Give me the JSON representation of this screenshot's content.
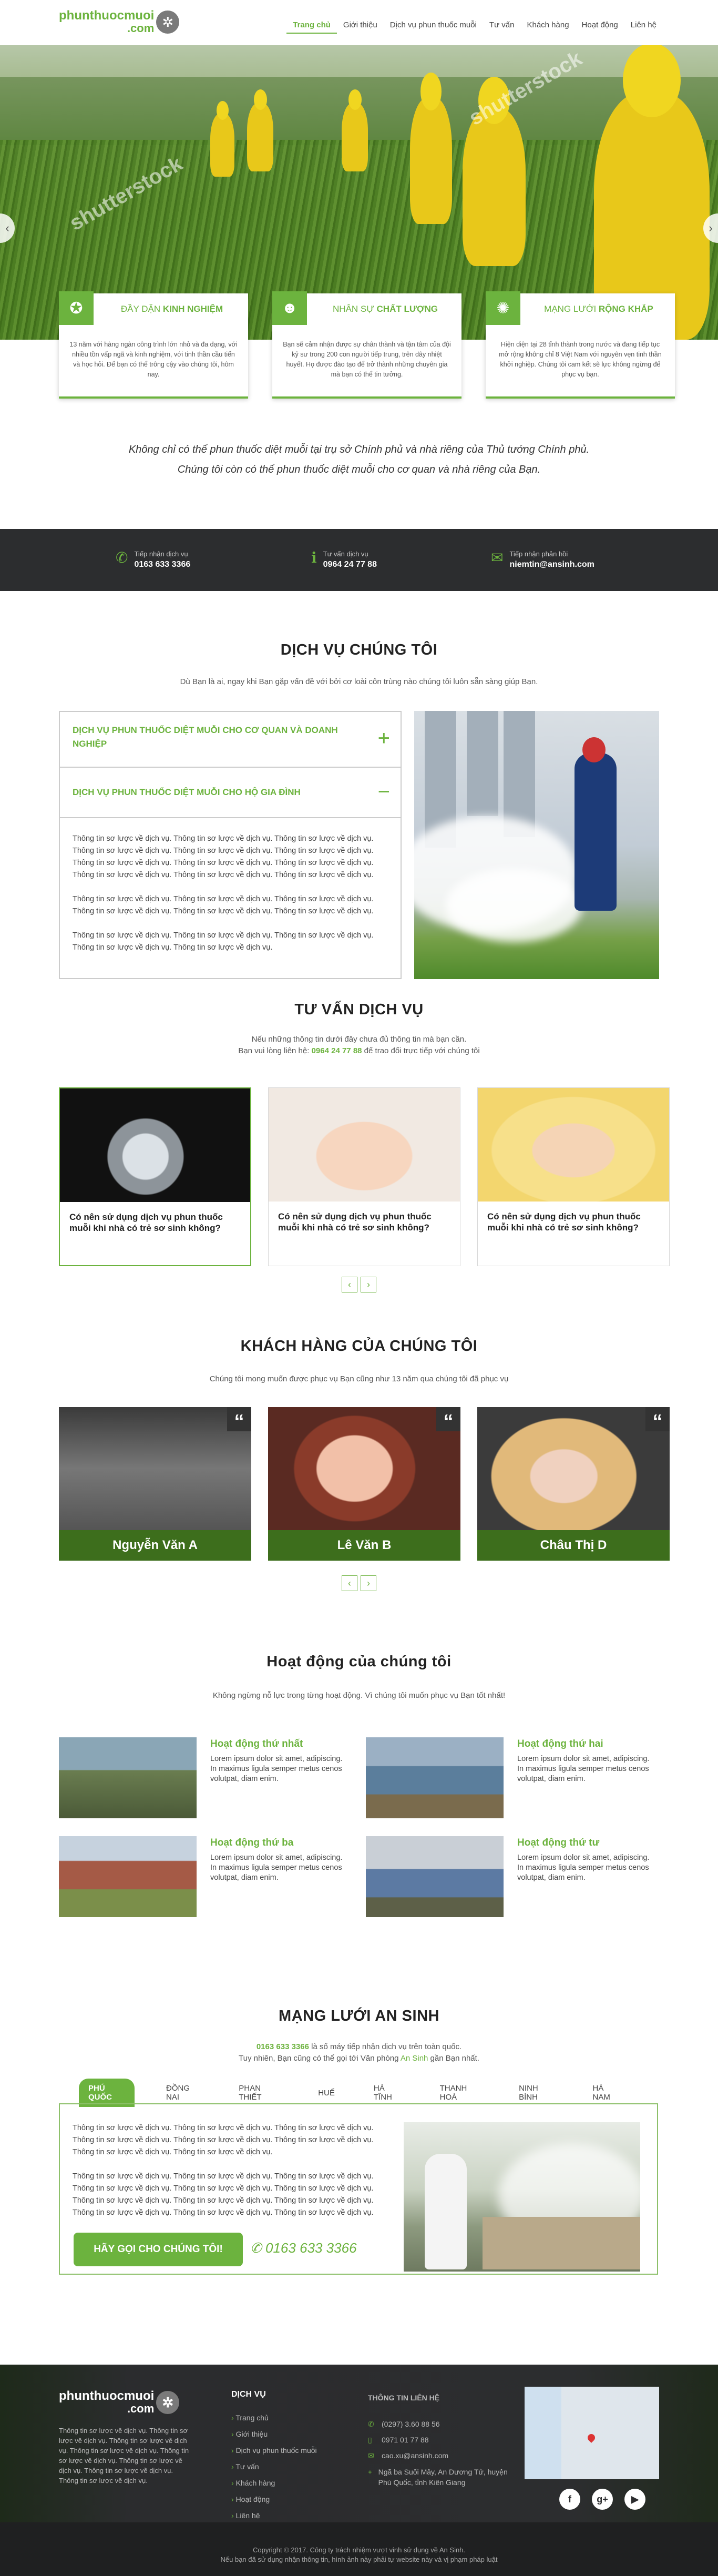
{
  "brand": {
    "line1": "phunthuocmuoi",
    "line2": ".com"
  },
  "nav": [
    {
      "label": "Trang chủ",
      "active": true
    },
    {
      "label": "Giới thiệu"
    },
    {
      "label": "Dịch vụ phun thuốc muỗi"
    },
    {
      "label": "Tư vấn"
    },
    {
      "label": "Khách hàng"
    },
    {
      "label": "Hoạt động"
    },
    {
      "label": "Liên hệ"
    }
  ],
  "hero": {
    "prev": "‹",
    "next": "›",
    "watermark": "shutterstock"
  },
  "features": [
    {
      "title_light": "ĐẦY DẶN",
      "title_bold": "KINH NGHIỆM",
      "text": "13 năm với hàng ngàn công trình lớn nhỏ và đa dạng, với nhiều tồn vấp ngã và kinh nghiệm, với tinh thần cầu tiến và học hỏi. Để bạn có thể trông cậy vào chúng tôi, hôm nay.",
      "icon": "award-icon"
    },
    {
      "title_light": "NHÂN SỰ",
      "title_bold": "CHẤT LƯỢNG",
      "text": "Bạn sẽ cảm nhận được sự chân thành và tận tâm của đội kỹ sư trong 200 con người tiếp trung, trên dây nhiệt huyết. Họ được đào tạo để trở thành những chuyên gia mà bạn có thể tin tưởng.",
      "icon": "user-icon"
    },
    {
      "title_light": "MẠNG LƯỚI",
      "title_bold": "RỘNG KHẮP",
      "text": "Hiện diện tại 28 tỉnh thành trong nước và đang tiếp tục mở rộng không chỉ 8 Việt Nam với nguyên vẹn tinh thần khởi nghiệp. Chúng tôi cam kết sẽ lực không ngừng để phục vụ bạn.",
      "icon": "network-icon"
    }
  ],
  "intro": {
    "line1": "Không chỉ có thể phun thuốc diệt muỗi tại trụ sở Chính phủ và nhà riêng của Thủ tướng Chính phủ.",
    "line2": "Chúng tôi còn có thể phun thuốc diệt muỗi cho cơ quan và nhà riêng của Bạn."
  },
  "contact_bar": [
    {
      "label": "Tiếp nhận dịch vụ",
      "value": "0163 633 3366",
      "icon": "phone-icon"
    },
    {
      "label": "Tư vấn dịch vụ",
      "value": "0964 24 77 88",
      "icon": "info-icon"
    },
    {
      "label": "Tiếp nhận phản hồi",
      "value": "niemtin@ansinh.com",
      "icon": "mail-icon"
    }
  ],
  "services": {
    "title": "DỊCH VỤ CHÚNG TÔI",
    "subtitle": "Dù Bạn là ai, ngay khi Bạn gặp vấn đề với bởi cơ loài côn trùng nào chúng tôi luôn sẵn sàng giúp Bạn.",
    "acc1": "DỊCH VỤ PHUN THUỐC DIỆT MUỖI CHO CƠ QUAN VÀ DOANH NGHIỆP",
    "acc1_toggle": "+",
    "acc2": "DỊCH VỤ PHUN THUỐC DIỆT MUỖI CHO HỘ GIA ĐÌNH",
    "acc2_toggle": "−",
    "p1": "Thông tin sơ lược về dịch vụ. Thông tin sơ lược về dịch vụ. Thông tin sơ lược về dịch vụ. Thông tin sơ lược về dịch vụ. Thông tin sơ lược về dịch vụ. Thông tin sơ lược về dịch vụ. Thông tin sơ lược về dịch vụ. Thông tin sơ lược về dịch vụ. Thông tin sơ lược về dịch vụ. Thông tin sơ lược về dịch vụ. Thông tin sơ lược về dịch vụ. Thông tin sơ lược về dịch vụ.",
    "p2": "Thông tin sơ lược về dịch vụ. Thông tin sơ lược về dịch vụ. Thông tin sơ lược về dịch vụ. Thông tin sơ lược về dịch vụ. Thông tin sơ lược về dịch vụ. Thông tin sơ lược về dịch vụ.",
    "p3": "Thông tin sơ lược về dịch vụ. Thông tin sơ lược về dịch vụ. Thông tin sơ lược về dịch vụ. Thông tin sơ lược về dịch vụ. Thông tin sơ lược về dịch vụ."
  },
  "consult": {
    "title": "TƯ VẤN DỊCH VỤ",
    "sub1": "Nếu những thông tin dưới đây chưa đủ thông tin mà bạn cần.",
    "sub2_a": "Bạn vui lòng liên hệ: ",
    "sub2_phone": "0964 24 77 88",
    "sub2_b": " để trao đổi trực tiếp với chúng tôi",
    "cards": [
      {
        "caption": "Có nên sử dụng dịch vụ phun thuốc muỗi khi nhà có trẻ sơ sinh không?"
      },
      {
        "caption": "Có nên sử dụng dịch vụ phun thuốc muỗi khi nhà có trẻ sơ sinh không?"
      },
      {
        "caption": "Có nên sử dụng dịch vụ phun thuốc muỗi khi nhà có trẻ sơ sinh không?"
      }
    ],
    "prev": "‹",
    "next": "›"
  },
  "customers": {
    "title": "KHÁCH HÀNG CỦA CHÚNG TÔI",
    "subtitle": "Chúng tôi mong muốn được phục vụ Bạn cũng như 13 năm qua chúng tôi đã phục vụ",
    "people": [
      {
        "name": "Nguyễn Văn A"
      },
      {
        "name": "Lê Văn B"
      },
      {
        "name": "Châu Thị D"
      }
    ],
    "quote": "“",
    "prev": "‹",
    "next": "›"
  },
  "activities": {
    "title": "Hoạt động của chúng tôi",
    "subtitle": "Không ngừng nỗ lực trong từng hoạt động. Vì chúng tôi muốn phục vụ Bạn tốt nhất!",
    "items": [
      {
        "title": "Hoạt động thứ nhất",
        "d1": "Lorem ipsum dolor sit amet, adipiscing.",
        "d2": "In maximus ligula semper metus cenos volutpat, diam enim."
      },
      {
        "title": "Hoạt động thứ hai",
        "d1": "Lorem ipsum dolor sit amet, adipiscing.",
        "d2": "In maximus ligula semper metus cenos volutpat, diam enim."
      },
      {
        "title": "Hoạt động thứ ba",
        "d1": "Lorem ipsum dolor sit amet, adipiscing.",
        "d2": "In maximus ligula semper metus cenos volutpat, diam enim."
      },
      {
        "title": "Hoạt động thứ tư",
        "d1": "Lorem ipsum dolor sit amet, adipiscing.",
        "d2": "In maximus ligula semper metus cenos volutpat, diam enim."
      }
    ]
  },
  "network": {
    "title": "MẠNG LƯỚI AN SINH",
    "sub1_phone": "0163 633 3366",
    "sub1_rest": " là số máy tiếp nhận dịch vụ trên toàn quốc.",
    "sub2_a": "Tuy nhiên, Bạn cũng có thể gọi tới Văn phòng ",
    "sub2_link": "An Sinh",
    "sub2_b": " gần Bạn nhất.",
    "tabs": [
      "PHÚ QUỐC",
      "ĐỒNG NAI",
      "PHAN THIẾT",
      "HUẾ",
      "HÀ TĨNH",
      "THANH HOÁ",
      "NINH BÌNH",
      "HÀ NAM"
    ],
    "p1": "Thông tin sơ lược về dịch vụ. Thông tin sơ lược về dịch vụ. Thông tin sơ lược về dịch vụ. Thông tin sơ lược về dịch vụ. Thông tin sơ lược về dịch vụ. Thông tin sơ lược về dịch vụ. Thông tin sơ lược về dịch vụ. Thông tin sơ lược về dịch vụ.",
    "p2": "Thông tin sơ lược về dịch vụ. Thông tin sơ lược về dịch vụ. Thông tin sơ lược về dịch vụ. Thông tin sơ lược về dịch vụ. Thông tin sơ lược về dịch vụ. Thông tin sơ lược về dịch vụ. Thông tin sơ lược về dịch vụ. Thông tin sơ lược về dịch vụ. Thông tin sơ lược về dịch vụ. Thông tin sơ lược về dịch vụ. Thông tin sơ lược về dịch vụ. Thông tin sơ lược về dịch vụ.",
    "button": "HÃY GỌI CHO CHÚNG TÔI!",
    "phone": "0163 633 3366"
  },
  "footer": {
    "about": "Thông tin sơ lược về dịch vụ. Thông tin sơ lược về dịch vụ. Thông tin sơ lược về dịch vụ. Thông tin sơ lược về dịch vụ. Thông tin sơ lược về dịch vụ. Thông tin sơ lược về dịch vụ. Thông tin sơ lược về dịch vụ. Thông tin sơ lược về dịch vụ.",
    "services_title": "DỊCH VỤ",
    "links": [
      "Trang chủ",
      "Giới thiệu",
      "Dịch vụ phun thuốc muỗi",
      "Tư vấn",
      "Khách hàng",
      "Hoạt động",
      "Liên hệ"
    ],
    "info_title": "THÔNG TIN LIÊN HỆ",
    "phone1": "(0297) 3.60 88 56",
    "phone2": "0971 01 77 88",
    "email": "cao.xu@ansinh.com",
    "address": "Ngã ba Suối Mây, An Dương Tử, huyện Phú Quốc, tỉnh Kiên Giang",
    "social": [
      "f",
      "g+",
      "▶"
    ],
    "copy1": "Copyright © 2017. Công ty trách nhiệm vượt vinh sử dụng về An Sinh.",
    "copy2": "Nếu bạn đã sử dụng nhận thông tin, hình ảnh này phải tự website này và vị phạm pháp luật"
  }
}
